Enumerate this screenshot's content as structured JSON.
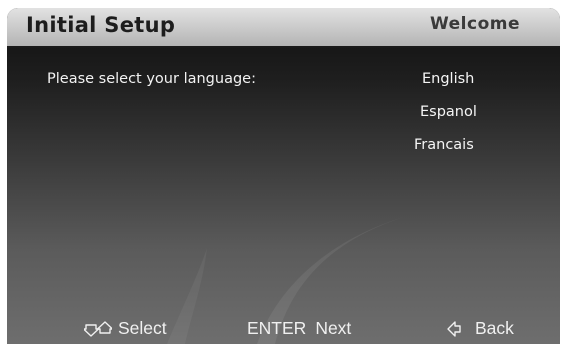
{
  "header": {
    "title": "Initial Setup",
    "section": "Welcome"
  },
  "main": {
    "prompt": "Please select your language:",
    "languages": [
      {
        "label": "English"
      },
      {
        "label": "Espanol"
      },
      {
        "label": "Francais"
      }
    ]
  },
  "footer": {
    "select_label": "Select",
    "enter_key": "ENTER",
    "next_label": "Next",
    "back_label": "Back",
    "select_icon": "down-up-arrows-icon",
    "back_icon": "left-arrow-icon"
  },
  "colors": {
    "header_bg": "#cfcfcf",
    "header_text": "#1d1d1d",
    "body_text": "#f2f2f2",
    "bg_top": "#0e0e0e",
    "bg_bottom": "#6e6e6e"
  }
}
